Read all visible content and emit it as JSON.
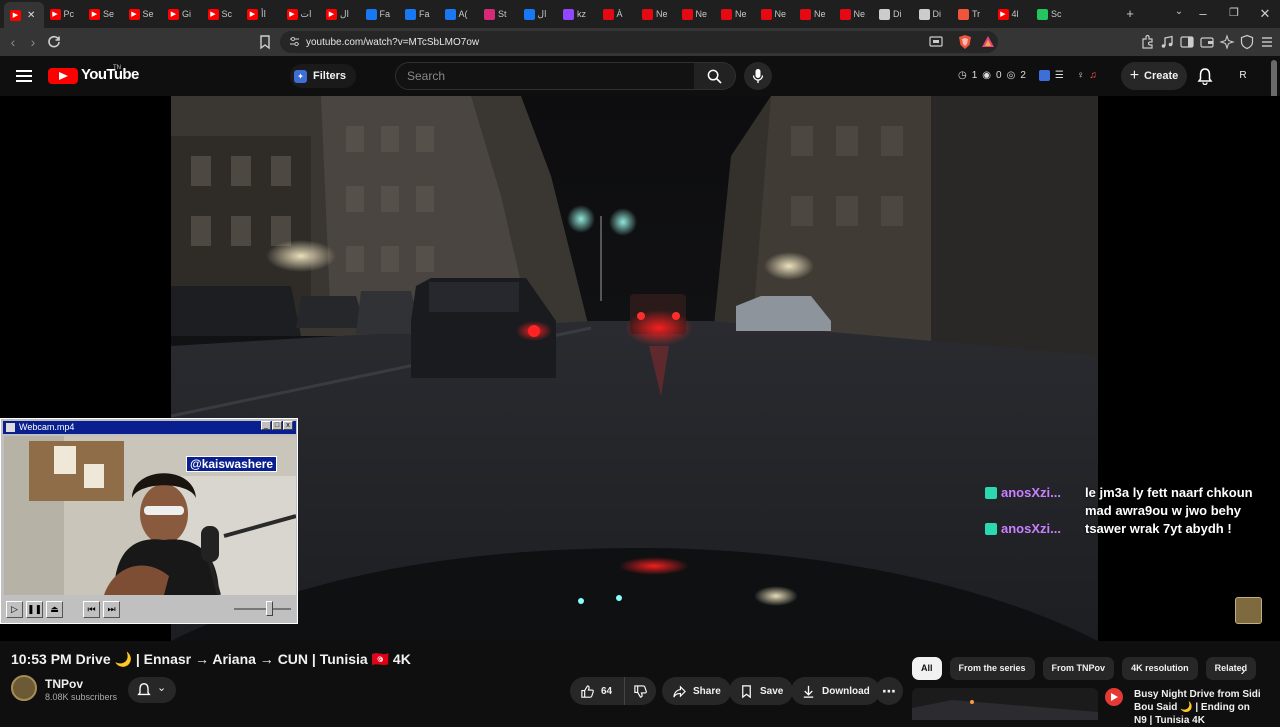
{
  "browser": {
    "tabs": [
      {
        "label": "",
        "icon": "youtube-icon",
        "color": "#ff0000",
        "active": true
      },
      {
        "label": "Pc",
        "icon": "youtube-icon",
        "color": "#ff0000"
      },
      {
        "label": "Se",
        "icon": "youtube-icon",
        "color": "#ff0000"
      },
      {
        "label": "Se",
        "icon": "youtube-icon",
        "color": "#ff0000"
      },
      {
        "label": "Gi",
        "icon": "youtube-icon",
        "color": "#ff0000"
      },
      {
        "label": "Sc",
        "icon": "youtube-icon",
        "color": "#ff0000"
      },
      {
        "label": "اأ",
        "icon": "youtube-icon",
        "color": "#ff0000"
      },
      {
        "label": "ات",
        "icon": "youtube-icon",
        "color": "#ff0000"
      },
      {
        "label": "ال",
        "icon": "youtube-icon",
        "color": "#ff0000"
      },
      {
        "label": "Fa",
        "icon": "facebook-icon",
        "color": "#1877f2"
      },
      {
        "label": "Fa",
        "icon": "facebook-icon",
        "color": "#1877f2"
      },
      {
        "label": "A(",
        "icon": "facebook-icon",
        "color": "#1877f2"
      },
      {
        "label": "St",
        "icon": "instagram-icon",
        "color": "#d62976"
      },
      {
        "label": "ال",
        "icon": "facebook-icon",
        "color": "#1877f2"
      },
      {
        "label": "kz",
        "icon": "twitch-icon",
        "color": "#9146ff"
      },
      {
        "label": "À",
        "icon": "netflix-icon",
        "color": "#e50914"
      },
      {
        "label": "Ne",
        "icon": "netflix-icon",
        "color": "#e50914"
      },
      {
        "label": "Ne",
        "icon": "netflix-icon",
        "color": "#e50914"
      },
      {
        "label": "Ne",
        "icon": "netflix-icon",
        "color": "#e50914"
      },
      {
        "label": "Ne",
        "icon": "netflix-icon",
        "color": "#e50914"
      },
      {
        "label": "Ne",
        "icon": "netflix-icon",
        "color": "#e50914"
      },
      {
        "label": "Ne",
        "icon": "netflix-icon",
        "color": "#e50914"
      },
      {
        "label": "Di",
        "icon": "x-icon",
        "color": "#cccccc"
      },
      {
        "label": "Di",
        "icon": "x-icon",
        "color": "#cccccc"
      },
      {
        "label": "Tr",
        "icon": "brave-icon",
        "color": "#f0553c"
      },
      {
        "label": "4l",
        "icon": "youtube-icon",
        "color": "#ff0000"
      },
      {
        "label": "Sc",
        "icon": "gradio-icon",
        "color": "#23c55e"
      }
    ],
    "url": "youtube.com/watch?v=MTcSbLMO7ow"
  },
  "youtube": {
    "logo_text": "YouTube",
    "logo_tm": "TN",
    "filters_label": "Filters",
    "search_placeholder": "Search",
    "stats": {
      "a": "1",
      "b": "0",
      "c": "2"
    },
    "create_label": "Create",
    "avatar_letter": "R"
  },
  "video": {
    "chat": [
      {
        "name": "anosXzi...",
        "message": "le jm3a ly fett naarf chkoun mad awra9ou w jwo behy"
      },
      {
        "name": "anosXzi...",
        "message": "tsawer wrak 7yt abydh !"
      }
    ],
    "webcam": {
      "title": "Webcam.mp4",
      "handle": "@kaiswashere"
    }
  },
  "meta": {
    "title": "10:53 PM Drive 🌙 | Ennasr → Ariana → CUN | Tunisia 🇹🇳 4K",
    "channel_name": "TNPov",
    "subscribers": "8.08K subscribers",
    "like_count": "64",
    "share_label": "Share",
    "save_label": "Save",
    "download_label": "Download"
  },
  "chips": [
    "All",
    "From the series",
    "From TNPov",
    "4K resolution",
    "Related"
  ],
  "related": {
    "title": "Busy Night Drive from Sidi Bou Said 🌙 | Ending on N9 | Tunisia 4K"
  },
  "colors": {
    "accent": "#ff0000",
    "chat_name": "#c880ff",
    "background": "#0f0f0f"
  }
}
